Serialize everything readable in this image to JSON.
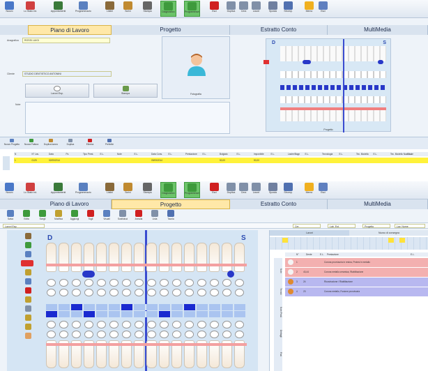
{
  "ribbon": {
    "buttons": [
      {
        "label": "Nuovo",
        "icon": "new-icon",
        "color": "#4a78c8"
      },
      {
        "label": "Lo Stato ed.",
        "icon": "state-icon",
        "color": "#d04040"
      },
      {
        "label": "Appuntamenti",
        "icon": "calendar-icon",
        "color": "#3a7a3a"
      },
      {
        "label": "Programmazione",
        "icon": "schedule-icon",
        "color": "#5a80c0"
      },
      {
        "label": "Listini",
        "icon": "list-icon",
        "color": "#8a6a3a"
      },
      {
        "label": "Scrivi",
        "icon": "write-icon",
        "color": "#c08a30"
      },
      {
        "label": "Stampa",
        "icon": "print-icon",
        "color": "#666666"
      },
      {
        "label": "Diagnostico",
        "icon": "diagnostic-icon",
        "color": "#3e9a3c"
      },
      {
        "label": "Programmazione",
        "icon": "program-icon",
        "color": "#3e9a3c"
      },
      {
        "label": "Esci",
        "icon": "exit-icon",
        "color": "#d02020"
      },
      {
        "label": "Duplica",
        "icon": "duplicate-icon",
        "color": "#8090a8"
      },
      {
        "label": "Cera",
        "icon": "wax-icon",
        "color": "#8090a8"
      },
      {
        "label": "Lavori",
        "icon": "jobs-icon",
        "color": "#8090a8"
      },
      {
        "label": "Sposta",
        "icon": "move-icon",
        "color": "#7080a0"
      },
      {
        "label": "Strump.",
        "icon": "tools-icon",
        "color": "#5070b0"
      },
      {
        "label": "Memo",
        "icon": "star-icon",
        "color": "#f0b020"
      },
      {
        "label": "Esci",
        "icon": "door-icon",
        "color": "#6080c0"
      }
    ]
  },
  "tabs": [
    "Piano di Lavoro",
    "Progetto",
    "Estratto Conto",
    "MultiMedia"
  ],
  "panel1": {
    "anagrafica_label": "Anagrafica",
    "anagrafica_value": "ROSSI LUIGI",
    "cliente_label": "Cliente",
    "cliente_value": "STUDIO DENTISTICO ANTONINI",
    "note_label": "Note",
    "btn1_label": "Lavori Esp.",
    "btn2_label": "Stampa",
    "photo_label": "Fotografia",
    "chart_top_letter": "D",
    "chart_top_letter_s": "S",
    "chart_bottom": "Progetto",
    "toolbar2": [
      "Nuovo Progetto",
      "Nuova Fattura",
      "Duplica lavoro",
      "Duplica",
      "Elimina",
      "Preferite"
    ],
    "columns": [
      "N",
      "N° Lav.",
      "Data",
      "Pz.",
      "Tipo Prest.",
      "E.L.",
      "Note",
      "E.L.",
      "Data Cons.",
      "E.L.",
      "Prestazione",
      "E.L.",
      "Bolgiato",
      "E.L.",
      "Imponibile",
      "E.L.",
      "Lastre/Bagn",
      "E.L.",
      "Tecnologia",
      "E.L.",
      "Tec. Modello",
      "E.L.",
      "Tec. Modello Nazionale",
      "E.L."
    ],
    "row": [
      "1",
      "0125",
      "02/05/2014",
      "",
      "",
      "",
      "",
      "",
      "09/05/2014",
      "",
      "",
      "",
      "50,00",
      "",
      "50,00",
      "",
      "",
      "",
      "",
      "",
      "",
      "",
      "",
      ""
    ]
  },
  "panel2": {
    "toolbar": [
      "Salva",
      "Edita",
      "Scegli",
      "Modifica",
      "Aggiungi",
      "Togli",
      "Visuali",
      "Sostituisci",
      "Annulla",
      "Lista",
      "Tavola"
    ],
    "filter_label": "Lavori Esp.",
    "top_search": [
      "Cer.",
      "Lab. Est.",
      "Progetto",
      "Lav. Nome"
    ],
    "right_tabs": [
      "Lavori",
      "Nuovo di consegna"
    ],
    "grid_header": [
      "",
      "N°",
      "Dente",
      "E.L.",
      "Prestazione",
      "E.L."
    ],
    "rows": [
      {
        "n": "1",
        "dente": "",
        "prest": "Corona provvisoria in resina, Protesi in metallo",
        "color": "#f3b0b0"
      },
      {
        "n": "2",
        "dente": "43,44",
        "prest": "Corona metallo ceramica, Riabilitazione",
        "color": "#f3b0b0"
      },
      {
        "n": "3",
        "dente": "24",
        "prest": "Ricostruzione / Riabilitazione",
        "color": "#b8b8f0"
      },
      {
        "n": "4",
        "dente": "23",
        "prest": "Corona metallo, Fusione provvisoria",
        "color": "#b8b8f0"
      }
    ],
    "side_labels": [
      "Note",
      "Tecnici",
      "Note Prod.",
      "Dettagli",
      "Fasi"
    ],
    "chart_letter_d": "D",
    "chart_letter_s": "S"
  }
}
